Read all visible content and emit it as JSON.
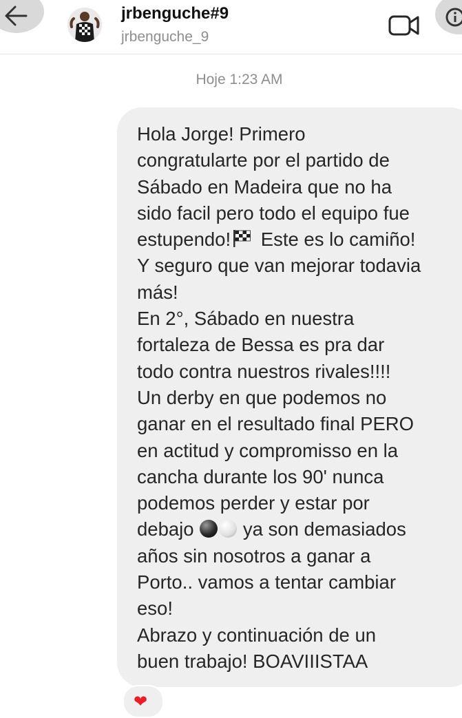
{
  "header": {
    "username": "jrbenguche#9",
    "handle": "jrbenguche_9",
    "icons": {
      "back": "arrow-left-icon",
      "video": "video-camera-icon",
      "info": "info-icon"
    }
  },
  "timestamp": "Hoje 1:23 AM",
  "message": {
    "lines": [
      "Hola Jorge! Primero",
      "congratularte por el partido de",
      "Sábado en Madeira que no ha",
      "sido facil pero todo el equipo fue",
      "estupendo!",
      "Este es lo camiño!",
      "Y seguro que van mejorar todavia",
      "más!",
      "En 2°, Sábado en nuestra",
      "fortaleza de Bessa es pra dar",
      "todo contra nuestros rivales!!!!",
      "Un derby en que podemos no",
      "ganar en el resultado final PERO",
      "en actitud y compromisso en la",
      "cancha durante los 90' nunca",
      "podemos perder y estar por",
      "debajo",
      "ya son demasiados",
      "años sin nosotros a ganar a",
      "Porto.. vamos a tentar cambiar",
      "eso!",
      "Abrazo y continuación de un",
      "buen trabajo! BOAVIIISTAA"
    ],
    "emoji": [
      "chequered-flag-icon",
      "black-ball-icon",
      "white-ball-icon"
    ]
  },
  "reaction": {
    "emoji": "❤",
    "color": "#ed1c24"
  },
  "colors": {
    "bubble": "#efefef",
    "secondary_text": "#8e8e8e",
    "heart": "#ed1c24"
  }
}
